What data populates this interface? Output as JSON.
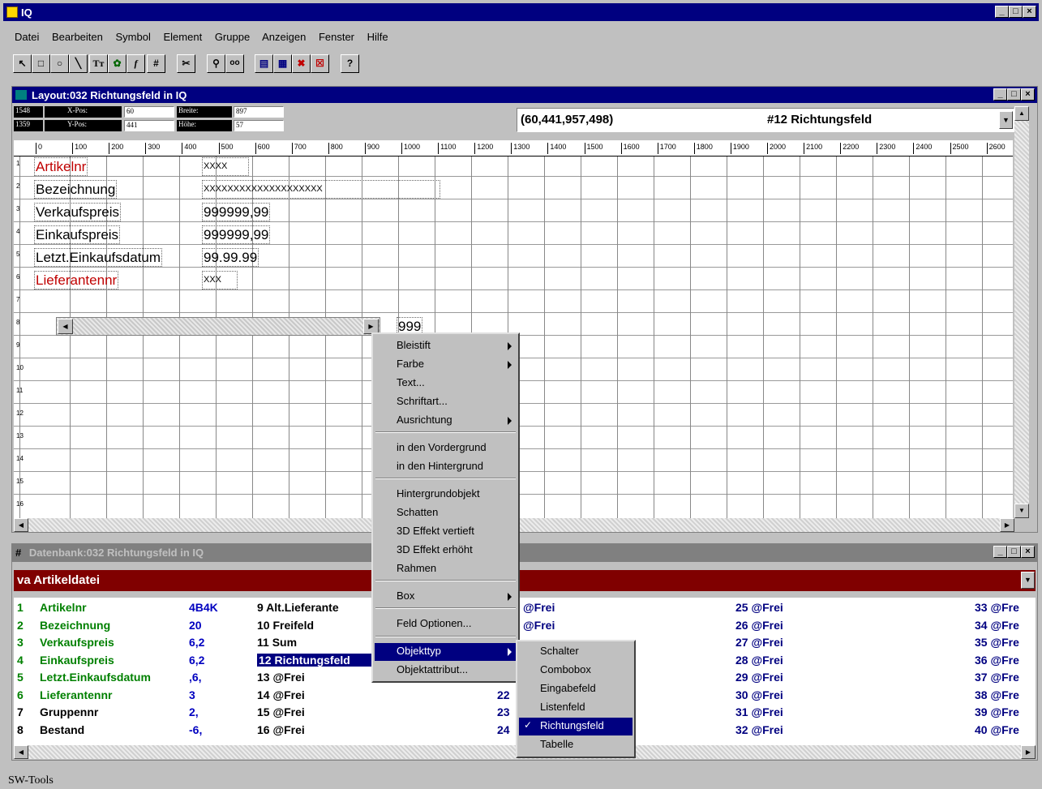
{
  "app": {
    "title": "IQ"
  },
  "menubar": [
    "Datei",
    "Bearbeiten",
    "Symbol",
    "Element",
    "Gruppe",
    "Anzeigen",
    "Fenster",
    "Hilfe"
  ],
  "layout_window": {
    "title": "Layout:032  Richtungsfeld in IQ",
    "info": {
      "v1": "1548",
      "v2": "1359",
      "xpos_label": "X-Pos:",
      "ypos_label": "Y-Pos:",
      "xpos": "60",
      "ypos": "441",
      "breite_label": "Breite:",
      "hoehe_label": "Höhe:",
      "breite": "897",
      "hoehe": "57"
    },
    "coords": "(60,441,957,498)",
    "object": "#12 Richtungsfeld",
    "ruler": [
      "0",
      "100",
      "200",
      "300",
      "400",
      "500",
      "600",
      "700",
      "800",
      "900",
      "1000",
      "1100",
      "1200",
      "1300",
      "1400",
      "1500",
      "1600",
      "1700",
      "1800",
      "1900",
      "2000",
      "2100",
      "2200",
      "2300",
      "2400",
      "2500",
      "2600"
    ],
    "rows": [
      "1",
      "2",
      "3",
      "4",
      "5",
      "6",
      "7",
      "8",
      "9",
      "10",
      "11",
      "12",
      "13",
      "14",
      "15",
      "16"
    ],
    "labels": [
      "Artikelnr",
      "Bezeichnung",
      "Verkaufspreis",
      "Einkaufspreis",
      "Letzt.Einkaufsdatum",
      "Lieferantennr"
    ],
    "values": [
      "XXXX",
      "XXXXXXXXXXXXXXXXXXXX",
      "999999,99",
      "999999,99",
      "99.99.99",
      "XXX"
    ],
    "value8": "999"
  },
  "context_menu": [
    "Bleistift",
    "Farbe",
    "Text...",
    "Schriftart...",
    "Ausrichtung",
    "in den Vordergrund",
    "in den Hintergrund",
    "Hintergrundobjekt",
    "Schatten",
    "3D Effekt vertieft",
    "3D Effekt erhöht",
    "Rahmen",
    "Box",
    "Feld Optionen...",
    "Objekttyp",
    "Objektattribut..."
  ],
  "submenu": [
    "Schalter",
    "Combobox",
    "Eingabefeld",
    "Listenfeld",
    "Richtungsfeld",
    "Tabelle"
  ],
  "db_window": {
    "title": "Datenbank:032  Richtungsfeld in IQ",
    "table": "va Artikeldatei",
    "col1": [
      {
        "n": "1",
        "name": "Artikelnr",
        "fmt": "4B4K"
      },
      {
        "n": "2",
        "name": "Bezeichnung",
        "fmt": "20"
      },
      {
        "n": "3",
        "name": "Verkaufspreis",
        "fmt": "6,2"
      },
      {
        "n": "4",
        "name": "Einkaufspreis",
        "fmt": "6,2"
      },
      {
        "n": "5",
        "name": "Letzt.Einkaufsdatum",
        "fmt": ",6,"
      },
      {
        "n": "6",
        "name": "Lieferantennr",
        "fmt": "3"
      },
      {
        "n": "7",
        "name": "Gruppennr",
        "fmt": "2,"
      },
      {
        "n": "8",
        "name": "Bestand",
        "fmt": "-6,"
      }
    ],
    "col2": [
      "9  Alt.Lieferante",
      "10 Freifeld",
      "11 Sum",
      "12 Richtungsfeld",
      "13 @Frei",
      "14 @Frei",
      "15 @Frei",
      "16 @Frei"
    ],
    "col3": [
      "@Frei",
      "@Frei",
      "",
      "",
      "",
      "22",
      "23",
      "24"
    ],
    "col4": [
      "25 @Frei",
      "26 @Frei",
      "27 @Frei",
      "28 @Frei",
      "29 @Frei",
      "30 @Frei",
      "31 @Frei",
      "32 @Frei"
    ],
    "col5": [
      "33 @Fre",
      "34 @Fre",
      "35 @Fre",
      "36 @Fre",
      "37 @Fre",
      "38 @Fre",
      "39 @Fre",
      "40 @Fre"
    ]
  },
  "statusbar": "SW-Tools"
}
